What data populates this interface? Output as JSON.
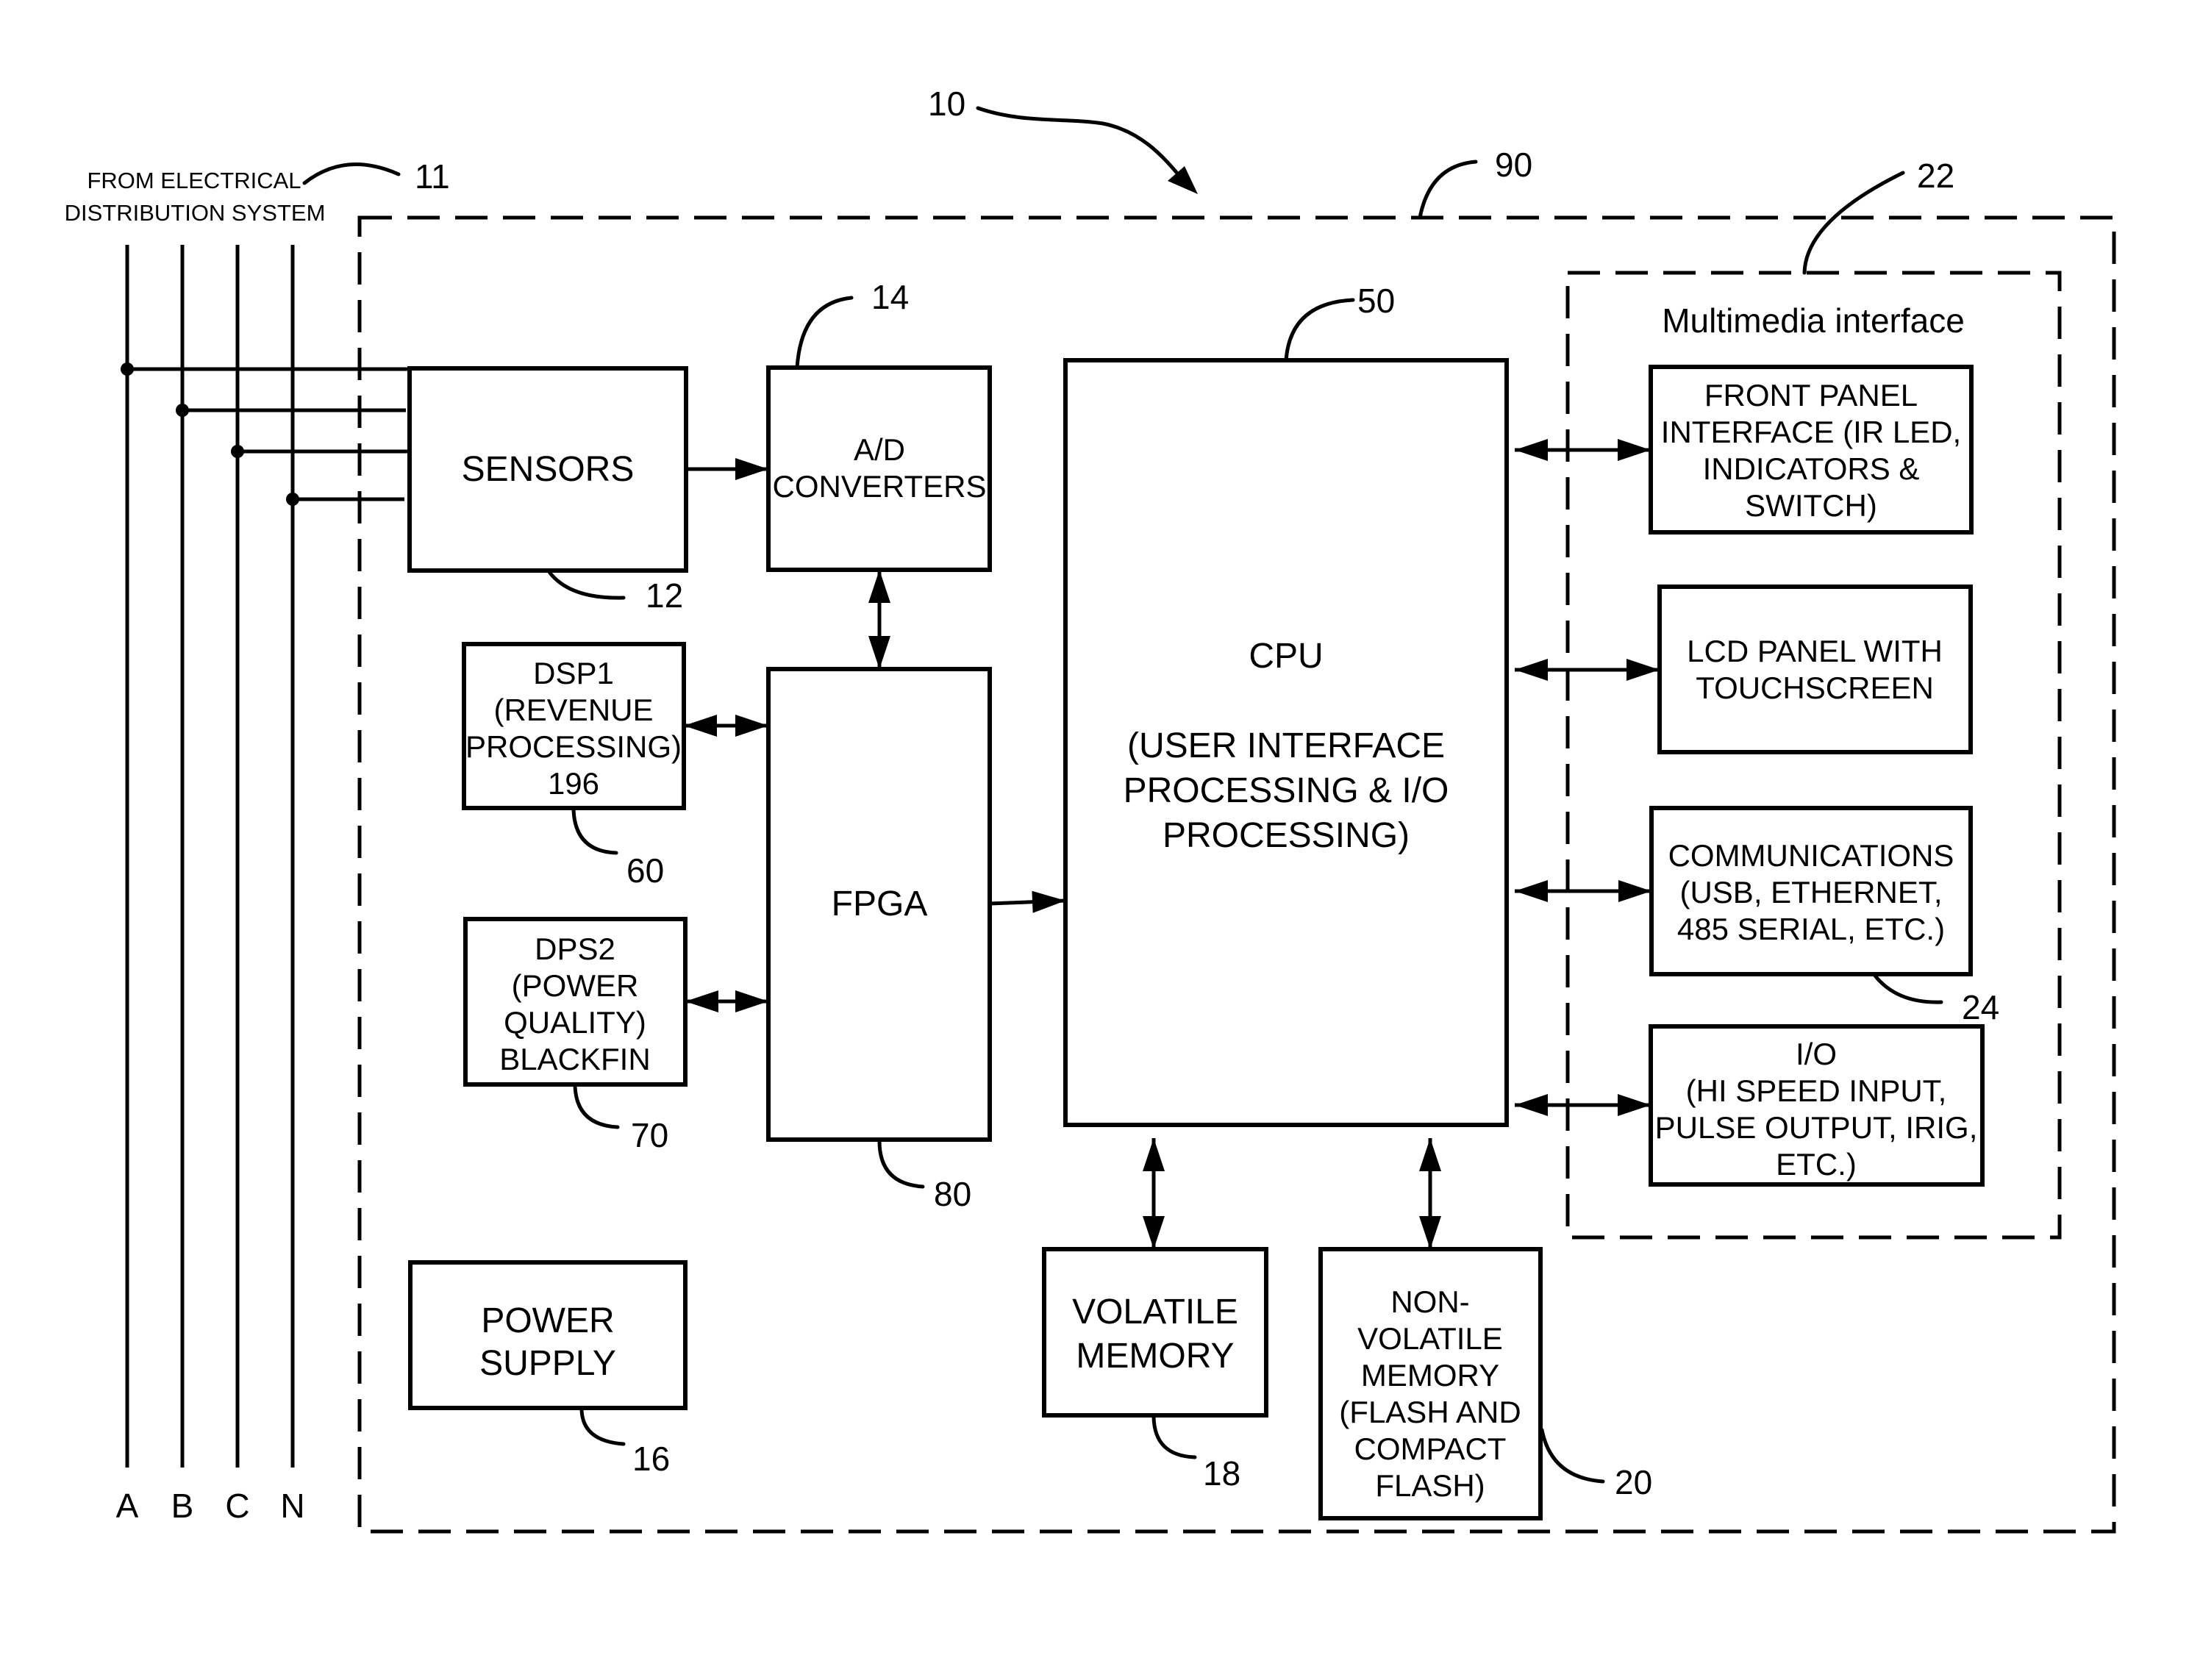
{
  "figure": {
    "device_ref": "10",
    "enclosure_ref": "90",
    "source": {
      "lines": [
        "FROM ELECTRICAL",
        "DISTRIBUTION SYSTEM"
      ],
      "ref": "11",
      "phases": [
        "A",
        "B",
        "C",
        "N"
      ]
    },
    "blocks": {
      "sensors": {
        "lines": [
          "SENSORS"
        ],
        "ref": "12"
      },
      "ad_converters": {
        "lines": [
          "A/D",
          "CONVERTERS"
        ],
        "ref": "14"
      },
      "dsp1": {
        "lines": [
          "DSP1",
          "(REVENUE",
          "PROCESSING)",
          "196"
        ],
        "ref": "60"
      },
      "dsp2": {
        "lines": [
          "DPS2",
          "(POWER",
          "QUALITY)",
          "BLACKFIN"
        ],
        "ref": "70"
      },
      "fpga": {
        "lines": [
          "FPGA"
        ],
        "ref": "80"
      },
      "cpu": {
        "lines": [
          "CPU",
          "",
          "(USER INTERFACE",
          "PROCESSING & I/O",
          "PROCESSING)"
        ],
        "ref": "50"
      },
      "power_supply": {
        "lines": [
          "POWER",
          "SUPPLY"
        ],
        "ref": "16"
      },
      "volatile_memory": {
        "lines": [
          "VOLATILE",
          "MEMORY"
        ],
        "ref": "18"
      },
      "nonvolatile_memory": {
        "lines": [
          "NON-",
          "VOLATILE",
          "MEMORY",
          "(FLASH AND",
          "COMPACT",
          "FLASH)"
        ],
        "ref": "20"
      }
    },
    "multimedia": {
      "title": "Multimedia interface",
      "ref": "22",
      "front_panel": {
        "lines": [
          "FRONT PANEL",
          "INTERFACE (IR LED,",
          "INDICATORS &",
          "SWITCH)"
        ]
      },
      "lcd": {
        "lines": [
          "LCD PANEL WITH",
          "TOUCHSCREEN"
        ]
      },
      "communications": {
        "lines": [
          "COMMUNICATIONS",
          "(USB, ETHERNET,",
          "485 SERIAL, ETC.)"
        ],
        "ref": "24"
      },
      "io": {
        "lines": [
          "I/O",
          "(HI SPEED INPUT,",
          "PULSE OUTPUT, IRIG,",
          "ETC.)"
        ]
      }
    },
    "connections": [
      {
        "from": "sensors",
        "to": "ad_converters",
        "direction": "one-way"
      },
      {
        "from": "ad_converters",
        "to": "fpga",
        "direction": "two-way"
      },
      {
        "from": "dsp1",
        "to": "fpga",
        "direction": "two-way"
      },
      {
        "from": "dsp2",
        "to": "fpga",
        "direction": "two-way"
      },
      {
        "from": "fpga",
        "to": "cpu",
        "direction": "one-way"
      },
      {
        "from": "cpu",
        "to": "front_panel",
        "direction": "two-way"
      },
      {
        "from": "cpu",
        "to": "lcd",
        "direction": "two-way"
      },
      {
        "from": "cpu",
        "to": "communications",
        "direction": "two-way"
      },
      {
        "from": "cpu",
        "to": "io",
        "direction": "two-way"
      },
      {
        "from": "cpu",
        "to": "volatile_memory",
        "direction": "two-way"
      },
      {
        "from": "cpu",
        "to": "nonvolatile_memory",
        "direction": "two-way"
      }
    ]
  }
}
